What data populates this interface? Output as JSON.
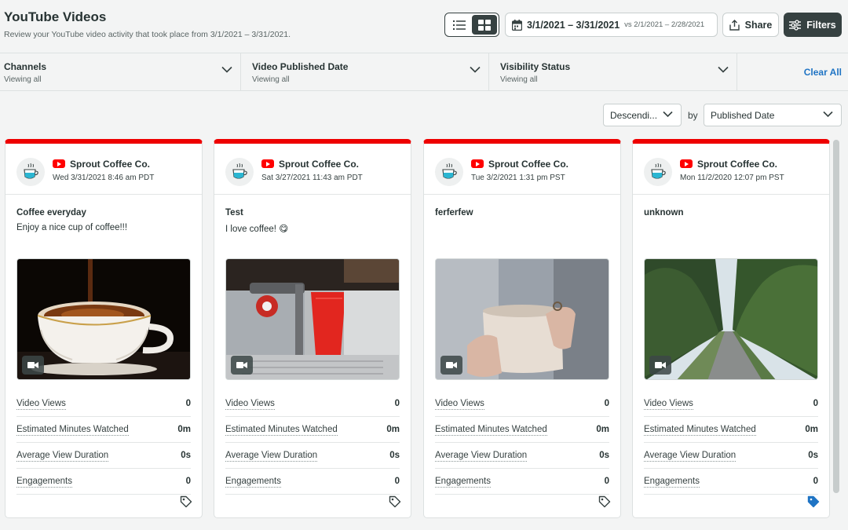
{
  "header": {
    "title": "YouTube Videos",
    "subtitle": "Review your YouTube video activity that took place from 3/1/2021 – 3/31/2021.",
    "date_range": "3/1/2021 – 3/31/2021",
    "compare_range": "vs 2/1/2021 – 2/28/2021",
    "share_label": "Share",
    "filters_label": "Filters",
    "view_modes": [
      "list-icon",
      "grid-icon"
    ],
    "active_view": "grid"
  },
  "filters": [
    {
      "label": "Channels",
      "value": "Viewing all"
    },
    {
      "label": "Video Published Date",
      "value": "Viewing all"
    },
    {
      "label": "Visibility Status",
      "value": "Viewing all"
    }
  ],
  "clear_all_label": "Clear All",
  "sort": {
    "order": "Descendi...",
    "by_label": "by",
    "field": "Published Date"
  },
  "colors": {
    "accent_dark": "#364141",
    "youtube_red": "#ee0000",
    "link_blue": "#1f74c4"
  },
  "cards": [
    {
      "channel": "Sprout Coffee Co.",
      "date": "Wed 3/31/2021 8:46 am PDT",
      "title": "Coffee everyday",
      "description": "Enjoy a nice cup of coffee!!!",
      "thumbnail": "coffee-cup-pour",
      "metrics": [
        {
          "label": "Video Views",
          "value": "0"
        },
        {
          "label": "Estimated Minutes Watched",
          "value": "0m"
        },
        {
          "label": "Average View Duration",
          "value": "0s"
        },
        {
          "label": "Engagements",
          "value": "0"
        }
      ],
      "tagged": false
    },
    {
      "channel": "Sprout Coffee Co.",
      "date": "Sat 3/27/2021 11:43 am PDT",
      "title": "Test",
      "description": "I love coffee! 😋",
      "thumbnail": "espresso-machine",
      "metrics": [
        {
          "label": "Video Views",
          "value": "0"
        },
        {
          "label": "Estimated Minutes Watched",
          "value": "0m"
        },
        {
          "label": "Average View Duration",
          "value": "0s"
        },
        {
          "label": "Engagements",
          "value": "0"
        }
      ],
      "tagged": false
    },
    {
      "channel": "Sprout Coffee Co.",
      "date": "Tue 3/2/2021 1:31 pm PST",
      "title": "ferferfew",
      "description": "",
      "thumbnail": "hands-holding-mug",
      "metrics": [
        {
          "label": "Video Views",
          "value": "0"
        },
        {
          "label": "Estimated Minutes Watched",
          "value": "0m"
        },
        {
          "label": "Average View Duration",
          "value": "0s"
        },
        {
          "label": "Engagements",
          "value": "0"
        }
      ],
      "tagged": false
    },
    {
      "channel": "Sprout Coffee Co.",
      "date": "Mon 11/2/2020 12:07 pm PST",
      "title": "unknown",
      "description": "",
      "thumbnail": "forest-road",
      "metrics": [
        {
          "label": "Video Views",
          "value": "0"
        },
        {
          "label": "Estimated Minutes Watched",
          "value": "0m"
        },
        {
          "label": "Average View Duration",
          "value": "0s"
        },
        {
          "label": "Engagements",
          "value": "0"
        }
      ],
      "tagged": true
    }
  ]
}
